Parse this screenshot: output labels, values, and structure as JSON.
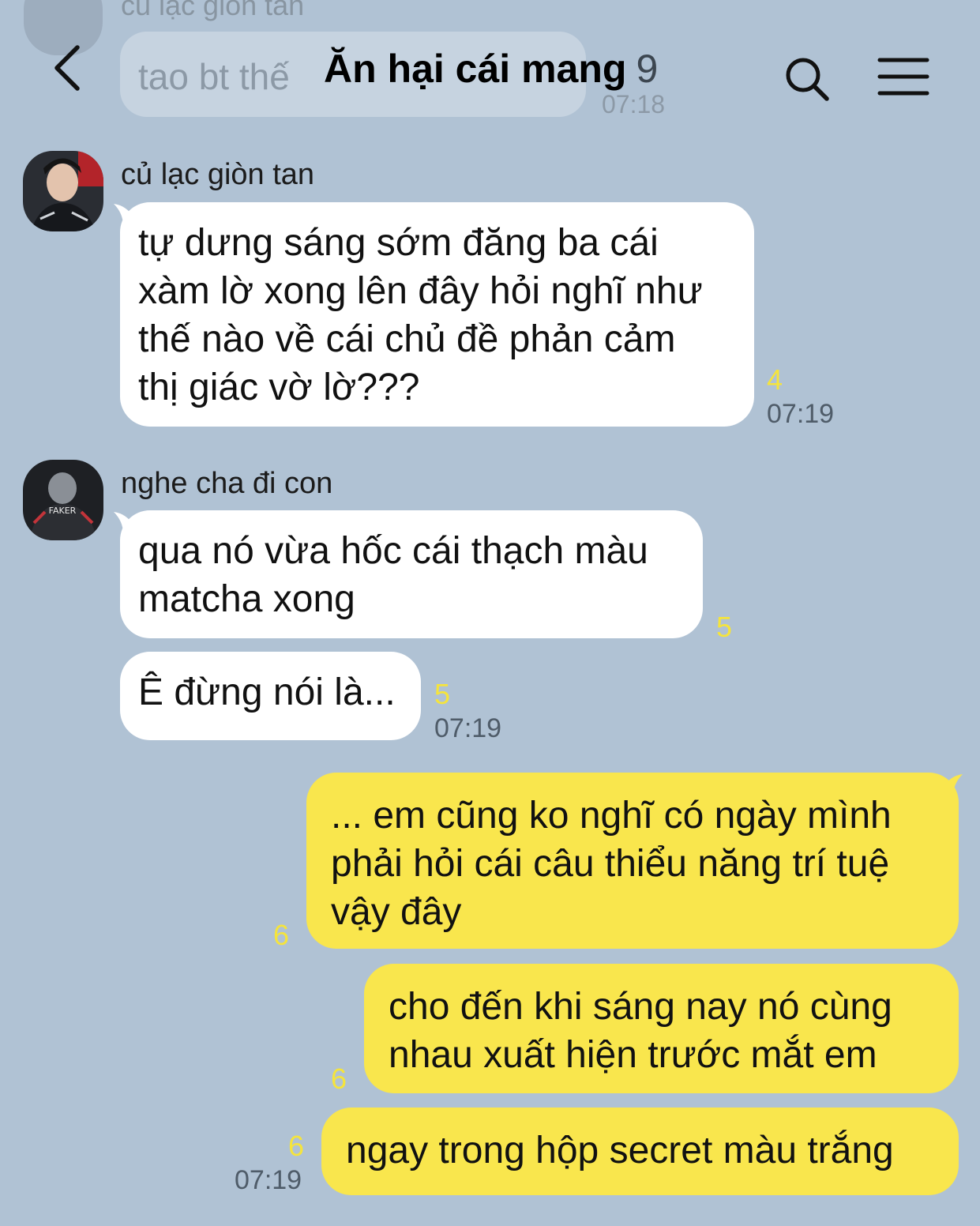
{
  "header": {
    "title": "Ăn hại cái mang",
    "member_count": "9"
  },
  "faded_message": {
    "sender": "củ lạc giòn tan",
    "text": "tao bt thế",
    "time": "07:18"
  },
  "messages": [
    {
      "sender": "củ lạc giòn tan",
      "lines": [
        "tự dưng sáng sớm đăng ba cái",
        "xàm lờ xong lên đây hỏi nghĩ như",
        "thế nào về cái chủ đề phản cảm",
        "thị giác vờ lờ???"
      ],
      "unread": "4",
      "time": "07:19"
    },
    {
      "sender": "nghe cha đi con",
      "lines": [
        "qua nó vừa hốc cái thạch màu",
        "matcha xong"
      ],
      "unread": "5"
    },
    {
      "lines": [
        "Ê đừng nói là..."
      ],
      "unread": "5",
      "time": "07:19"
    },
    {
      "lines": [
        "... em cũng ko nghĩ có ngày mình",
        "phải hỏi cái câu thiểu năng trí tuệ",
        "vậy đây"
      ],
      "unread": "6"
    },
    {
      "lines": [
        "cho đến khi sáng nay nó cùng",
        "nhau xuất hiện trước mắt em"
      ],
      "unread": "6"
    },
    {
      "lines": [
        "ngay trong hộp secret màu trắng"
      ],
      "unread": "6",
      "time": "07:19"
    }
  ],
  "colors": {
    "background": "#b0c2d4",
    "incoming_bubble": "#ffffff",
    "outgoing_bubble": "#f9e64d",
    "unread_count": "#f5e43c"
  }
}
